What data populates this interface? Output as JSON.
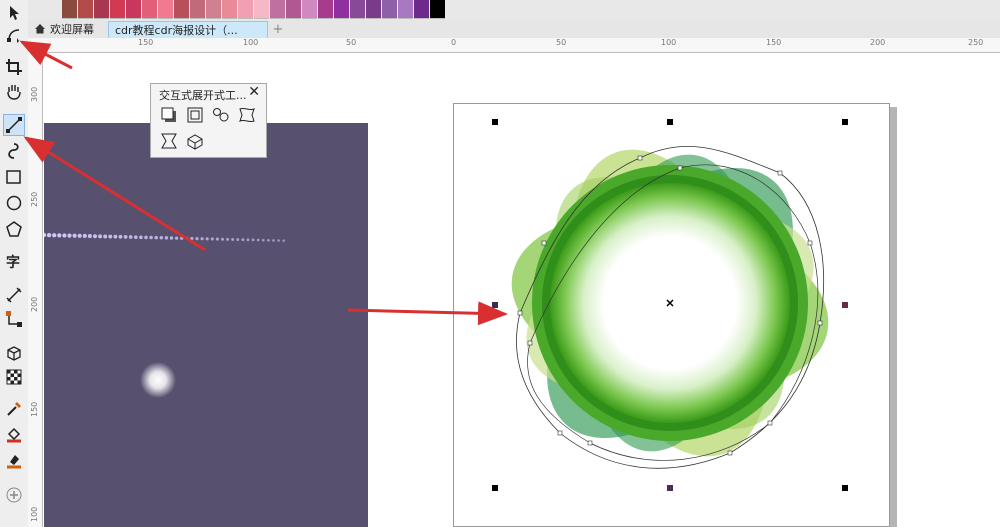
{
  "palette_colors": [
    "#8b4a3e",
    "#b34b4b",
    "#a8384f",
    "#d23a54",
    "#c8385e",
    "#e0607a",
    "#f07a90",
    "#b8505c",
    "#c06a7a",
    "#d08090",
    "#e88a98",
    "#f0a0b0",
    "#f6b8c6",
    "#c070a0",
    "#b05890",
    "#d088c0",
    "#a83c8c",
    "#9030a0",
    "#884a98",
    "#7a3c8a",
    "#8e60a8",
    "#a878c0",
    "#6e2a8a",
    "#000000"
  ],
  "tabs": {
    "welcome_label": "欢迎屏幕",
    "doc_label": "cdr教程cdr海报设计（...",
    "add_label": "+"
  },
  "ruler": {
    "top_labels": [
      "150",
      "100",
      "50",
      "0",
      "50",
      "100",
      "150",
      "200",
      "250"
    ],
    "left_labels": [
      "300",
      "250",
      "200",
      "150",
      "100"
    ]
  },
  "flyout": {
    "title": "交互式展开式工...",
    "close_label": "✕",
    "icons": [
      "drop-shadow-icon",
      "contour-icon",
      "blend-icon",
      "distort-icon",
      "envelope-icon",
      "extrude-icon"
    ]
  },
  "colors": {
    "dark_panel": "#58506f",
    "arrow_red": "#d83030",
    "flower_green": "#3aa020"
  }
}
